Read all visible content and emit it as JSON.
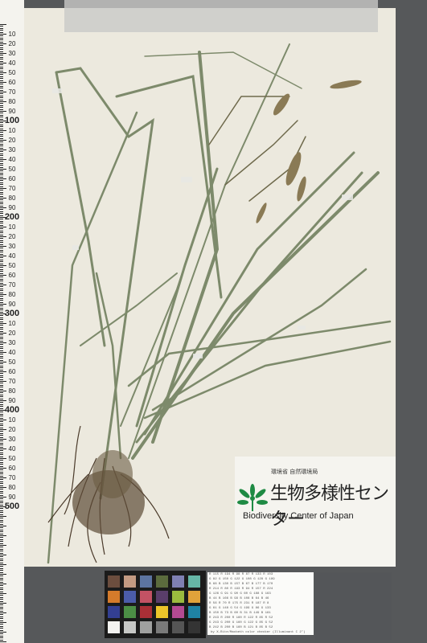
{
  "ruler": {
    "major_labels": [
      "10",
      "100",
      "200",
      "300",
      "400",
      "500"
    ],
    "minor_labels": [
      "20",
      "30",
      "40",
      "50",
      "60",
      "70",
      "80",
      "90",
      "10",
      "20",
      "30",
      "40",
      "50",
      "60",
      "70",
      "80",
      "90",
      "10",
      "20",
      "30",
      "40",
      "50",
      "60",
      "70",
      "80",
      "90",
      "10",
      "20",
      "30",
      "40",
      "50",
      "60",
      "70",
      "80",
      "90",
      "10",
      "20",
      "30",
      "40",
      "50",
      "60",
      "70",
      "80",
      "90"
    ]
  },
  "label": {
    "organization": "環境省 自然環境局",
    "title_jp": "生物多様性センター",
    "title_en": "Biodiversity Center of Japan",
    "logo_icon": "biodiversity-logo-icon",
    "logo_color": "#1e8a43"
  },
  "color_checker": {
    "colors": [
      "#6b4d3e",
      "#c39a82",
      "#5c74a0",
      "#5b6b3d",
      "#7f80b3",
      "#66b6a6",
      "#d57b2b",
      "#4b5ca9",
      "#c35264",
      "#5a3e6a",
      "#9bbb3e",
      "#e1a23a",
      "#333f92",
      "#4c8f45",
      "#a92f36",
      "#ecc52a",
      "#b44a92",
      "#1f82a4",
      "#f2f2f0",
      "#c7c8c6",
      "#a0a1a0",
      "#7a7a7a",
      "#555555",
      "#343434"
    ],
    "table_rows": [
      "R 115 R 194 R 98  R 87  R 133 R 103",
      "G 82  G 150 G 122 G 108 G 128 G 189",
      "B 68  B 130 B 157 B 67  B 177 B 170",
      "R 214 R 80  R 193 R 94  R 157 R 224",
      "G 126 G 91  G 90  G 60  G 188 G 163",
      "B 44  B 166 B 99  B 108 B 64  B 46",
      "R 56  R 70  R 175 R 231 R 187 R 8",
      "G 61  G 148 G 54  G 199 G 86  G 133",
      "B 150 B 73  B 60  B 31  B 149 B 161",
      "R 243 R 200 R 160 R 122 R 85  R 52",
      "G 243 G 200 G 160 G 122 G 85  G 52",
      "B 242 B 200 B 160 B 121 B 85  B 52"
    ],
    "caption": "by X-Rite/Macbeth color checker (Illuminant C 2°)"
  }
}
